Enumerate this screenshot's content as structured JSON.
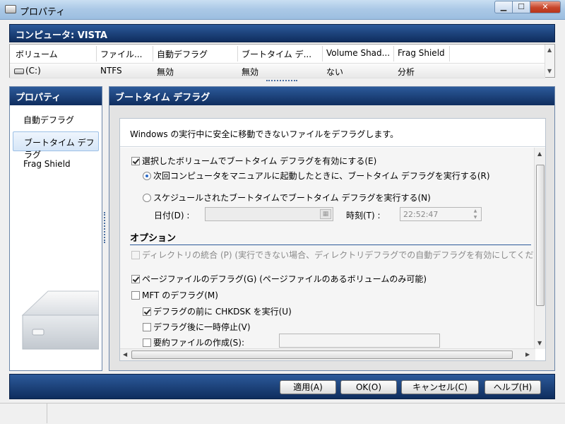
{
  "window": {
    "title": "プロパティ"
  },
  "computer": {
    "label": "コンピュータ: VISTA"
  },
  "volume_table": {
    "columns": [
      "ボリューム",
      "ファイル...",
      "自動デフラグ",
      "ブートタイム デ...",
      "Volume Shad...",
      "Frag Shield"
    ],
    "rows": [
      {
        "volume": "(C:)",
        "fs": "NTFS",
        "auto": "無効",
        "boot": "無効",
        "shadow": "ない",
        "frag": "分析"
      }
    ]
  },
  "left_panel": {
    "title": "プロパティ",
    "items": [
      "自動デフラグ",
      "ブートタイム デフラグ",
      "Frag Shield"
    ]
  },
  "right_panel": {
    "title": "ブートタイム デフラグ",
    "description": "Windows の実行中に安全に移動できないファイルをデフラグします。",
    "enable_label": "選択したボリュームでブートタイム デフラグを有効にする(E)",
    "radio_next": "次回コンピュータをマニュアルに起動したときに、ブートタイム デフラグを実行する(R)",
    "radio_sched": "スケジュールされたブートタイムでブートタイム デフラグを実行する(N)",
    "date_label": "日付(D) :",
    "time_label": "時刻(T) :",
    "time_value": "22:52:47",
    "options_title": "オプション",
    "dir_merge": "ディレクトリの統合 (P) (実行できない場合、ディレクトリデフラグでの自動デフラグを有効にしてください)",
    "pagefile": "ページファイルのデフラグ(G) (ページファイルのあるボリュームのみ可能)",
    "mft": "MFT のデフラグ(M)",
    "chkdsk": "デフラグの前に CHKDSK を実行(U)",
    "pause": "デフラグ後に一時停止(V)",
    "summary": "要約ファイルの作成(S):"
  },
  "buttons": {
    "apply": "適用(A)",
    "ok": "OK(O)",
    "cancel": "キャンセル(C)",
    "help": "ヘルプ(H)"
  }
}
